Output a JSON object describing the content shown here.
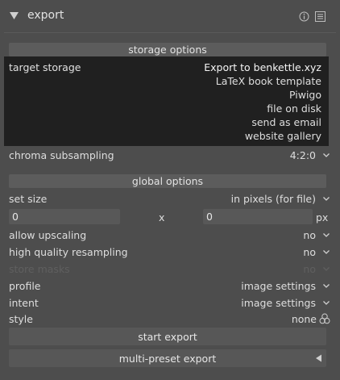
{
  "module": {
    "title": "export"
  },
  "storage": {
    "section_label": "storage options",
    "target_label": "target storage",
    "options": [
      "Export to benkettle.xyz",
      "LaTeX book template",
      "Piwigo",
      "file on disk",
      "send as email",
      "website gallery"
    ],
    "chroma_label": "chroma subsampling",
    "chroma_value": "4:2:0"
  },
  "global": {
    "section_label": "global options",
    "set_size_label": "set size",
    "set_size_value": "in pixels (for file)",
    "width_value": "0",
    "x_label": "x",
    "height_value": "0",
    "px_label": "px",
    "allow_upscaling_label": "allow upscaling",
    "allow_upscaling_value": "no",
    "hq_resampling_label": "high quality resampling",
    "hq_resampling_value": "no",
    "store_masks_label": "store masks",
    "store_masks_value": "no",
    "profile_label": "profile",
    "profile_value": "image settings",
    "intent_label": "intent",
    "intent_value": "image settings",
    "style_label": "style",
    "style_value": "none"
  },
  "actions": {
    "start_export_label": "start export",
    "multi_preset_label": "multi-preset export"
  },
  "colors": {
    "panel_bg": "#4d4d4d",
    "list_bg": "#202020",
    "section_bg": "#5c5c5c"
  }
}
